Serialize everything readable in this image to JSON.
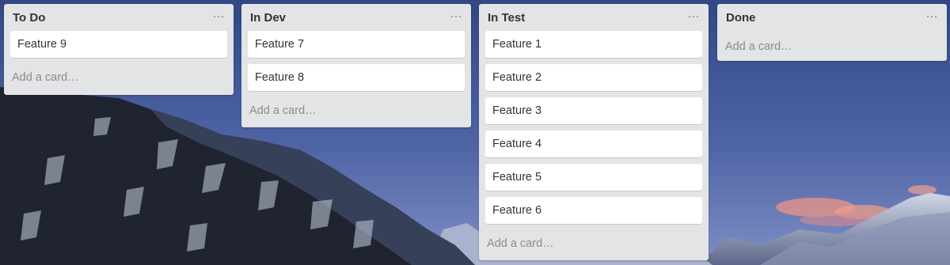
{
  "board": {
    "add_card_label": "Add a card…",
    "menu_icon": "more-horizontal-icon",
    "lists": [
      {
        "title": "To Do",
        "cards": [
          "Feature 9"
        ]
      },
      {
        "title": "In Dev",
        "cards": [
          "Feature 7",
          "Feature 8"
        ]
      },
      {
        "title": "In Test",
        "cards": [
          "Feature 1",
          "Feature 2",
          "Feature 3",
          "Feature 4",
          "Feature 5",
          "Feature 6"
        ]
      },
      {
        "title": "Done",
        "cards": []
      }
    ]
  },
  "background": {
    "description_icon": "mountain-landscape",
    "sky_color": "#4a5f9e",
    "sunset_cloud_color": "#e89a8c",
    "snow_color": "#dde3ef"
  }
}
